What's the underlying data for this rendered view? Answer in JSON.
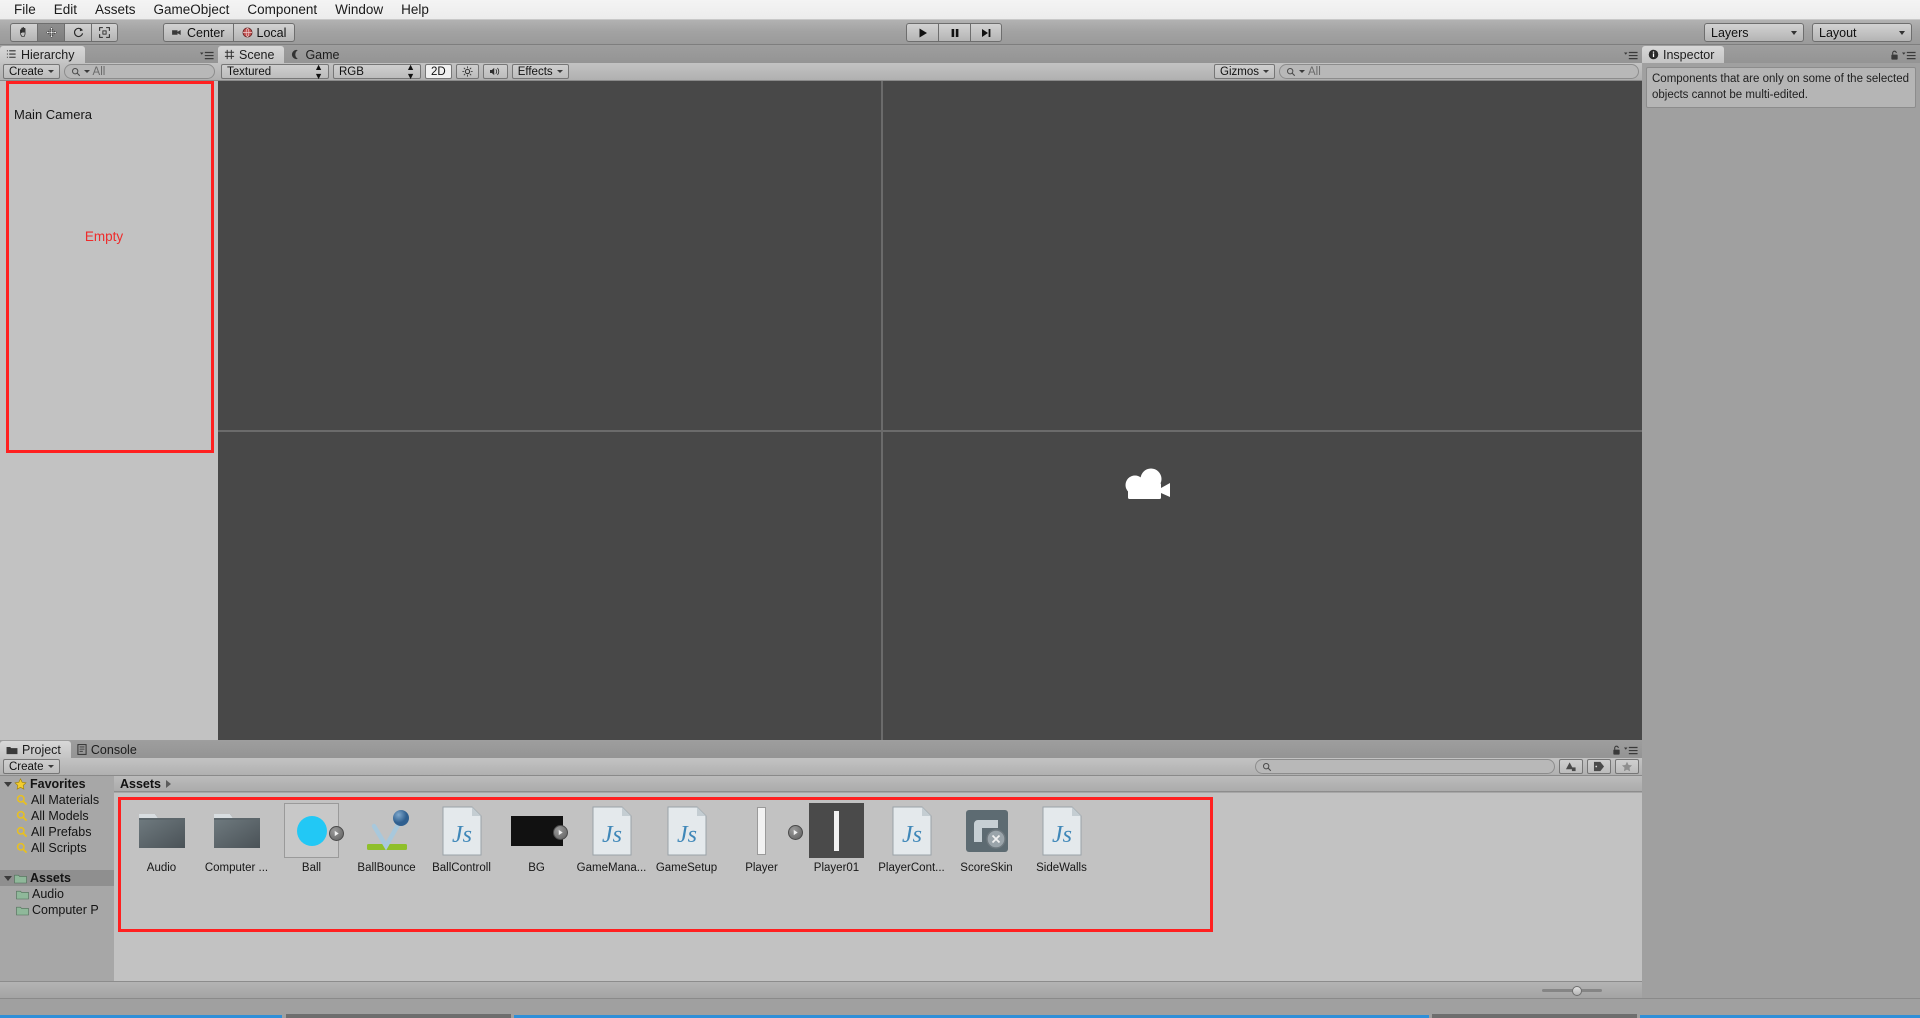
{
  "menubar": {
    "items": [
      {
        "label": "File"
      },
      {
        "label": "Edit"
      },
      {
        "label": "Assets"
      },
      {
        "label": "GameObject"
      },
      {
        "label": "Component"
      },
      {
        "label": "Window"
      },
      {
        "label": "Help"
      }
    ]
  },
  "toolbar": {
    "transform_tools": [
      {
        "name": "hand-tool",
        "active": false
      },
      {
        "name": "move-tool",
        "active": true
      },
      {
        "name": "rotate-tool",
        "active": false
      },
      {
        "name": "scale-tool",
        "active": false
      }
    ],
    "pivot_mode": "Center",
    "pivot_rotation": "Local",
    "play_controls": [
      {
        "name": "play-button",
        "glyph": "play"
      },
      {
        "name": "pause-button",
        "glyph": "pause"
      },
      {
        "name": "step-button",
        "glyph": "step"
      }
    ],
    "layers_label": "Layers",
    "layout_label": "Layout"
  },
  "hierarchy": {
    "tab_label": "Hierarchy",
    "create_label": "Create",
    "search_placeholder": "All",
    "items": [
      {
        "label": "Main Camera"
      }
    ],
    "empty_text": "Empty",
    "highlight_color": "#ff2020"
  },
  "scene": {
    "tabs": [
      {
        "label": "Scene",
        "active": true,
        "icon": "grid-icon"
      },
      {
        "label": "Game",
        "active": false,
        "icon": "moon-icon"
      }
    ],
    "draw_mode": "Textured",
    "render_mode": "RGB",
    "view_2d_label": "2D",
    "lighting_icon": "sun-icon",
    "audio_icon": "speaker-icon",
    "effects_label": "Effects",
    "gizmos_label": "Gizmos",
    "gizmos_search_placeholder": "All",
    "background_color": "#484848",
    "grid_color": "#6b6b6b",
    "camera_gizmo_name": "Main Camera"
  },
  "inspector": {
    "tab_label": "Inspector",
    "message": "Components that are only on some of the selected objects cannot be multi-edited."
  },
  "project": {
    "tabs": [
      {
        "label": "Project",
        "active": true,
        "icon": "folder-icon"
      },
      {
        "label": "Console",
        "active": false,
        "icon": "console-icon"
      }
    ],
    "create_label": "Create",
    "search_placeholder": "",
    "breadcrumb": "Assets",
    "tree": [
      {
        "label": "Favorites",
        "type": "header",
        "icon": "star-icon",
        "indent": 0,
        "expanded": true
      },
      {
        "label": "All Materials",
        "type": "search",
        "icon": "magnifier-icon",
        "indent": 1
      },
      {
        "label": "All Models",
        "type": "search",
        "icon": "magnifier-icon",
        "indent": 1
      },
      {
        "label": "All Prefabs",
        "type": "search",
        "icon": "magnifier-icon",
        "indent": 1
      },
      {
        "label": "All Scripts",
        "type": "search",
        "icon": "magnifier-icon",
        "indent": 1
      },
      {
        "label": "Assets",
        "type": "header",
        "icon": "folder-icon",
        "indent": 0,
        "expanded": true,
        "selected": true
      },
      {
        "label": "Audio",
        "type": "folder",
        "icon": "folder-icon",
        "indent": 1
      },
      {
        "label": "Computer P",
        "type": "folder",
        "icon": "folder-icon",
        "indent": 1
      }
    ],
    "assets": [
      {
        "label": "Audio",
        "kind": "folder"
      },
      {
        "label": "Computer ...",
        "kind": "folder"
      },
      {
        "label": "Ball",
        "kind": "prefab-circle",
        "color": "#22c8f5"
      },
      {
        "label": "BallBounce",
        "kind": "physic-material"
      },
      {
        "label": "BallControll",
        "kind": "js-script"
      },
      {
        "label": "BG",
        "kind": "prefab-dark",
        "color": "#111111"
      },
      {
        "label": "GameMana...",
        "kind": "js-script"
      },
      {
        "label": "GameSetup",
        "kind": "js-script"
      },
      {
        "label": "Player",
        "kind": "prefab-paddle"
      },
      {
        "label": "Player01",
        "kind": "prefab-paddle-dark"
      },
      {
        "label": "PlayerCont...",
        "kind": "js-script"
      },
      {
        "label": "ScoreSkin",
        "kind": "gui-skin"
      },
      {
        "label": "SideWalls",
        "kind": "js-script"
      }
    ],
    "highlight_color": "#ff2020",
    "filter_icons": [
      {
        "name": "type-filter-icon"
      },
      {
        "name": "label-filter-icon"
      },
      {
        "name": "favorite-filter-icon"
      }
    ],
    "zoom_value": 50
  }
}
